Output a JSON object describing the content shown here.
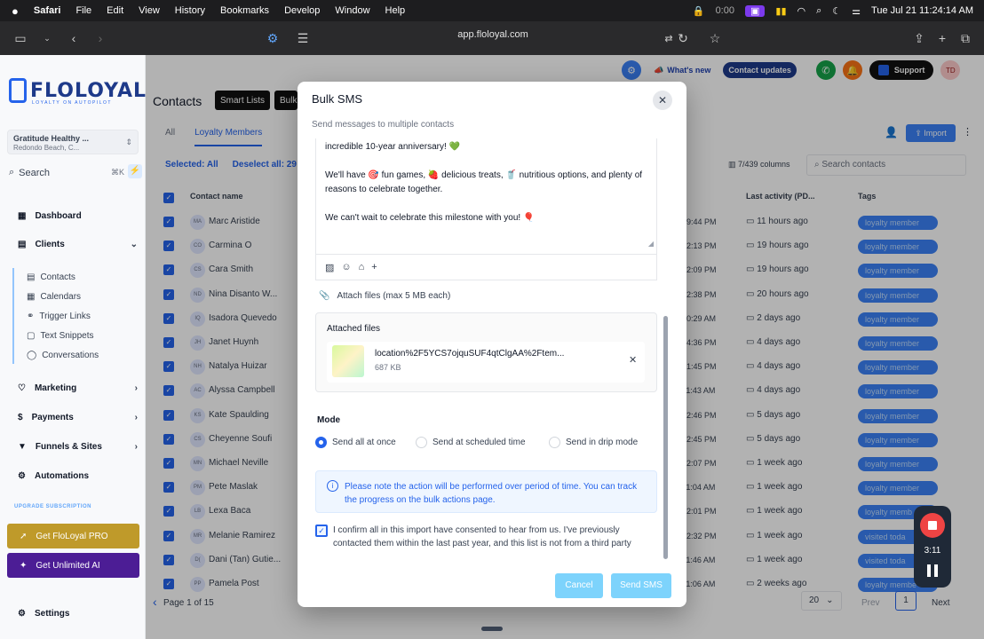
{
  "menubar": {
    "apple": "",
    "app": "Safari",
    "items": [
      "File",
      "Edit",
      "View",
      "History",
      "Bookmarks",
      "Develop",
      "Window",
      "Help"
    ],
    "timer": "0:00",
    "clock": "Tue Jul 21  11:24:14 AM"
  },
  "browser": {
    "url": "app.floloyal.com"
  },
  "brand": {
    "name": "FLOLOYAL",
    "tagline": "LOYALTY ON AUTOPILOT",
    "accent": "#2563eb"
  },
  "location": {
    "name": "Gratitude Healthy ...",
    "sub": "Redondo Beach, C..."
  },
  "search": {
    "label": "Search",
    "shortcut": "⌘K"
  },
  "nav": {
    "dashboard": "Dashboard",
    "clients": "Clients",
    "contacts": "Contacts",
    "calendars": "Calendars",
    "trigger_links": "Trigger Links",
    "text_snippets": "Text Snippets",
    "conversations": "Conversations",
    "marketing": "Marketing",
    "payments": "Payments",
    "funnels": "Funnels & Sites",
    "automations": "Automations",
    "upgrade": "UPGRADE SUBSCRIPTION",
    "pro": "Get FloLoyal PRO",
    "ai": "Get Unlimited AI",
    "settings": "Settings"
  },
  "topbar": {
    "whats_new": "What's new",
    "contact_updates": "Contact updates",
    "support": "Support",
    "initials": "TD"
  },
  "contacts": {
    "title": "Contacts",
    "chip1": "Smart Lists",
    "chip2": "Bulk",
    "tab_all": "All",
    "tab_loyalty": "Loyalty Members",
    "selected_all": "Selected: All",
    "deselect": "Deselect all: 29",
    "columns": "7/439 columns",
    "search_placeholder": "Search contacts",
    "import": "Import",
    "col_name": "Contact name",
    "col_activity": "Last activity (PD...",
    "col_tags": "Tags",
    "rows": [
      {
        "initials": "MA",
        "name": "Marc Aristide",
        "time": "09:44 PM",
        "activity": "11 hours ago",
        "tag": "loyalty member"
      },
      {
        "initials": "CO",
        "name": "Carmina O",
        "time": "02:13 PM",
        "activity": "19 hours ago",
        "tag": "loyalty member"
      },
      {
        "initials": "CS",
        "name": "Cara Smith",
        "time": "02:09 PM",
        "activity": "19 hours ago",
        "tag": "loyalty member"
      },
      {
        "initials": "ND",
        "name": "Nina Disanto W...",
        "time": "12:38 PM",
        "activity": "20 hours ago",
        "tag": "loyalty member"
      },
      {
        "initials": "IQ",
        "name": "Isadora Quevedo",
        "time": "10:29 AM",
        "activity": "2 days ago",
        "tag": "loyalty member"
      },
      {
        "initials": "JH",
        "name": "Janet Huynh",
        "time": "04:36 PM",
        "activity": "4 days ago",
        "tag": "loyalty member"
      },
      {
        "initials": "NH",
        "name": "Natalya Huizar",
        "time": "01:45 PM",
        "activity": "4 days ago",
        "tag": "loyalty member"
      },
      {
        "initials": "AC",
        "name": "Alyssa Campbell",
        "time": "11:43 AM",
        "activity": "4 days ago",
        "tag": "loyalty member"
      },
      {
        "initials": "KS",
        "name": "Kate Spaulding",
        "time": "02:46 PM",
        "activity": "5 days ago",
        "tag": "loyalty member"
      },
      {
        "initials": "CS",
        "name": "Cheyenne Soufi",
        "time": "02:45 PM",
        "activity": "5 days ago",
        "tag": "loyalty member"
      },
      {
        "initials": "MN",
        "name": "Michael Neville",
        "time": "12:07 PM",
        "activity": "1 week ago",
        "tag": "loyalty member"
      },
      {
        "initials": "PM",
        "name": "Pete Maslak",
        "time": "11:04 AM",
        "activity": "1 week ago",
        "tag": "loyalty member"
      },
      {
        "initials": "LB",
        "name": "Lexa Baca",
        "time": "12:01 PM",
        "activity": "1 week ago",
        "tag": "loyalty memb"
      },
      {
        "initials": "MR",
        "name": "Melanie Ramirez",
        "time": "02:32 PM",
        "activity": "1 week ago",
        "tag": "visited toda"
      },
      {
        "initials": "D(",
        "name": "Dani (Tan) Gutie...",
        "time": "11:46 AM",
        "activity": "1 week ago",
        "tag": "visited toda"
      },
      {
        "initials": "PP",
        "name": "Pamela Post",
        "time": "11:06 AM",
        "activity": "2 weeks ago",
        "tag": "loyalty membe"
      }
    ],
    "page_text": "Page 1 of 15",
    "per_page": "20",
    "prev": "Prev",
    "page": "1",
    "next": "Next"
  },
  "modal": {
    "title": "Bulk SMS",
    "subtitle": "Send messages to multiple contacts",
    "line1": "incredible 10-year anniversary! 💚",
    "line2": "We'll have 🎯 fun games, 🍓 delicious treats, 🥤 nutritious options, and plenty of reasons to celebrate together.",
    "line3": "We can't wait to celebrate this milestone with you! 🎈",
    "attach": "Attach files (max 5 MB each)",
    "attached_header": "Attached files",
    "file_name": "location%2F5YCS7ojquSUF4qtClgAA%2Ftem...",
    "file_size": "687 KB",
    "mode_label": "Mode",
    "mode_options": [
      "Send all at once",
      "Send at scheduled time",
      "Send in drip mode"
    ],
    "info": "Please note the action will be performed over period of time. You can track the progress on the bulk actions page.",
    "confirm": "I confirm all in this import have consented to hear from us. I've previously contacted them within the last past year, and this list is not from a third party",
    "cancel": "Cancel",
    "send": "Send SMS"
  },
  "recorder": {
    "time": "3:11"
  }
}
